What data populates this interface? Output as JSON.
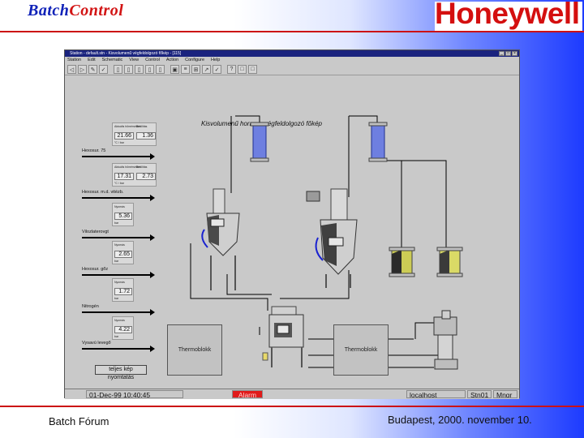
{
  "slide": {
    "title_part1": "Batch",
    "title_part2": "Control",
    "logo_text": "Honeywell",
    "footer_left": "Batch Fórum",
    "footer_right": "Budapest, 2000. november 10.",
    "accent_red": "#cc1111",
    "accent_blue": "#1022b8"
  },
  "window": {
    "title": "Station - default.stn - Kisvolumenű végfeldolgozó főkép - [115]",
    "controls": [
      "minimize",
      "maximize",
      "close"
    ],
    "menu": [
      "Station",
      "Edit",
      "Schematic",
      "View",
      "Control",
      "Action",
      "Configure",
      "Help"
    ],
    "toolbar_icons": [
      "back-icon",
      "forward-icon",
      "tools-icon",
      "check-icon",
      "page-icon",
      "page2-icon",
      "page3-icon",
      "page4-icon",
      "page5-icon",
      "monitor-icon",
      "list-icon",
      "grid-icon",
      "arrow-icon",
      "ack-icon",
      "help-icon",
      "box-icon",
      "box2-icon"
    ]
  },
  "schematic": {
    "title": "Kisvolumenű hormon-végfeldolgozó főkép",
    "process_lines": [
      "Hexosur. 75",
      "Hexosur. m.d. vitézb.",
      "Vilozlaterovgt",
      "Hexosur. gőz",
      "Nitrogén",
      "Vysavú levegő"
    ],
    "panels": [
      {
        "label1": "Aktuális hőmérséklet",
        "label2": "Beállítás",
        "value1": "21.66",
        "value2": "1.36",
        "unit": "°C / bar"
      },
      {
        "label1": "Aktuális hőmérséklet",
        "label2": "Beállítás",
        "value1": "17.31",
        "value2": "2.73",
        "unit": "°C / bar"
      },
      {
        "label1": "Nyomás",
        "value1": "5.36",
        "unit": "bar"
      },
      {
        "label1": "Nyomás",
        "value1": "2.65",
        "unit": "bar"
      },
      {
        "label1": "Nyomás",
        "value1": "1.72",
        "unit": "bar"
      },
      {
        "label1": "Nyomás",
        "value1": "4.22",
        "unit": "bar"
      }
    ],
    "boxes": {
      "left": "Thermoblokk",
      "right": "Thermoblokk"
    },
    "print_button": "teljes kép nyomtatás"
  },
  "statusbar": {
    "datetime": "01-Dec-99 10:40:45",
    "alarm": "Alarm",
    "server": "localhost",
    "station": "Stn01",
    "mode": "Mngr"
  }
}
